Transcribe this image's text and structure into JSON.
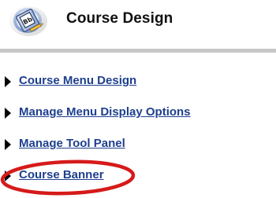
{
  "header": {
    "title": "Course Design",
    "icon": "bb-blueprint-icon"
  },
  "menu": {
    "items": [
      {
        "label": "Course Menu Design",
        "icon": "arrow-right-icon"
      },
      {
        "label": "Manage Menu Display Options",
        "icon": "arrow-right-icon"
      },
      {
        "label": "Manage Tool Panel",
        "icon": "arrow-right-icon"
      },
      {
        "label": "Course Banner",
        "icon": "arrow-right-icon",
        "highlighted": true
      }
    ]
  },
  "colors": {
    "link": "#1e3f8f",
    "highlight": "#d61a1a",
    "divider": "#c8c8c8"
  }
}
